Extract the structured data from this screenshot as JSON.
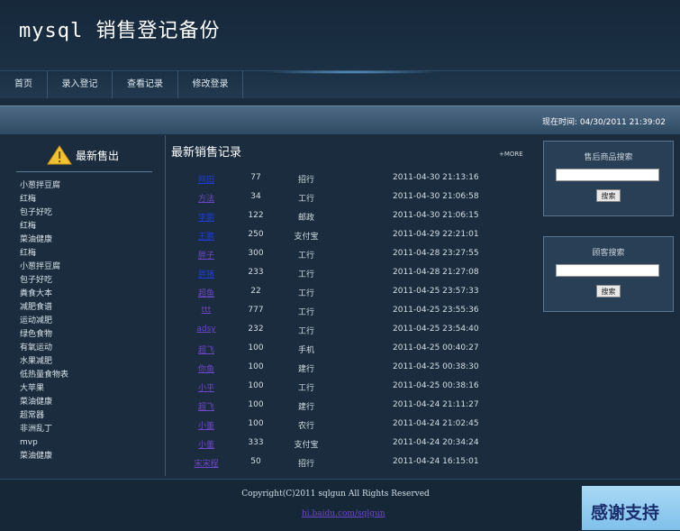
{
  "site": {
    "title": "mysql 销售登记备份"
  },
  "nav": [
    {
      "label": "首页"
    },
    {
      "label": "录入登记"
    },
    {
      "label": "查看记录"
    },
    {
      "label": "修改登录"
    }
  ],
  "banner": {
    "time_text": "现在时间: 04/30/2011 21:39:02"
  },
  "left": {
    "title": "最新售出",
    "items": [
      "小葱拌豆腐",
      "红梅",
      "包子好吃",
      "红梅",
      "菜油健康",
      "红梅",
      "小葱拌豆腐",
      "包子好吃",
      "粪食大本",
      "减肥食谱",
      "运动减肥",
      "绿色食物",
      "有氧运动",
      "水果减肥",
      "低热量食物表",
      "大苹果",
      "菜油健康",
      "超常器",
      "非洲乱丁",
      "mvp",
      "菜油健康"
    ]
  },
  "main": {
    "title": "最新销售记录",
    "more": "+MORE",
    "rows": [
      {
        "name": "网田",
        "qty": "77",
        "type": "招行",
        "date": "2011-04-30 21:13:16",
        "visited": true
      },
      {
        "name": "方法",
        "qty": "34",
        "type": "工行",
        "date": "2011-04-30 21:06:58",
        "visited": false
      },
      {
        "name": "李鹏",
        "qty": "122",
        "type": "邮政",
        "date": "2011-04-30 21:06:15",
        "visited": true
      },
      {
        "name": "王鹏",
        "qty": "250",
        "type": "支付宝",
        "date": "2011-04-29 22:21:01",
        "visited": true
      },
      {
        "name": "胖子",
        "qty": "300",
        "type": "工行",
        "date": "2011-04-28 23:27:55",
        "visited": false
      },
      {
        "name": "胖猪",
        "qty": "233",
        "type": "工行",
        "date": "2011-04-28 21:27:08",
        "visited": true
      },
      {
        "name": "超鱼",
        "qty": "22",
        "type": "工行",
        "date": "2011-04-25 23:57:33",
        "visited": false
      },
      {
        "name": "ttt",
        "qty": "777",
        "type": "工行",
        "date": "2011-04-25 23:55:36",
        "visited": false
      },
      {
        "name": "adsy",
        "qty": "232",
        "type": "工行",
        "date": "2011-04-25 23:54:40",
        "visited": false
      },
      {
        "name": "超飞",
        "qty": "100",
        "type": "手机",
        "date": "2011-04-25 00:40:27",
        "visited": false
      },
      {
        "name": "你鱼",
        "qty": "100",
        "type": "建行",
        "date": "2011-04-25 00:38:30",
        "visited": false
      },
      {
        "name": "小平",
        "qty": "100",
        "type": "工行",
        "date": "2011-04-25 00:38:16",
        "visited": false
      },
      {
        "name": "超飞",
        "qty": "100",
        "type": "建行",
        "date": "2011-04-24 21:11:27",
        "visited": false
      },
      {
        "name": "小董",
        "qty": "100",
        "type": "农行",
        "date": "2011-04-24 21:02:45",
        "visited": false
      },
      {
        "name": "小董",
        "qty": "333",
        "type": "支付宝",
        "date": "2011-04-24 20:34:24",
        "visited": false
      },
      {
        "name": "宋宋程",
        "qty": "50",
        "type": "招行",
        "date": "2011-04-24 16:15:01",
        "visited": false
      }
    ]
  },
  "search_product": {
    "title": "售后商品搜索",
    "value": "",
    "button": "搜索"
  },
  "search_customer": {
    "title": "顾客搜索",
    "value": "",
    "button": "搜索"
  },
  "footer": {
    "copyright": "Copyright(C)2011 sqlgun All Rights Reserved",
    "link": "hi.baidu.com/sqlgun"
  },
  "thanks": {
    "label": "感谢支持"
  },
  "colors": {
    "background": "#1a2c3d",
    "link": "#6f46c9",
    "visited_link": "#1f3bd6",
    "accent_icon": "#f2c230"
  },
  "icons": {
    "left_title_icon": "warning-icon"
  }
}
